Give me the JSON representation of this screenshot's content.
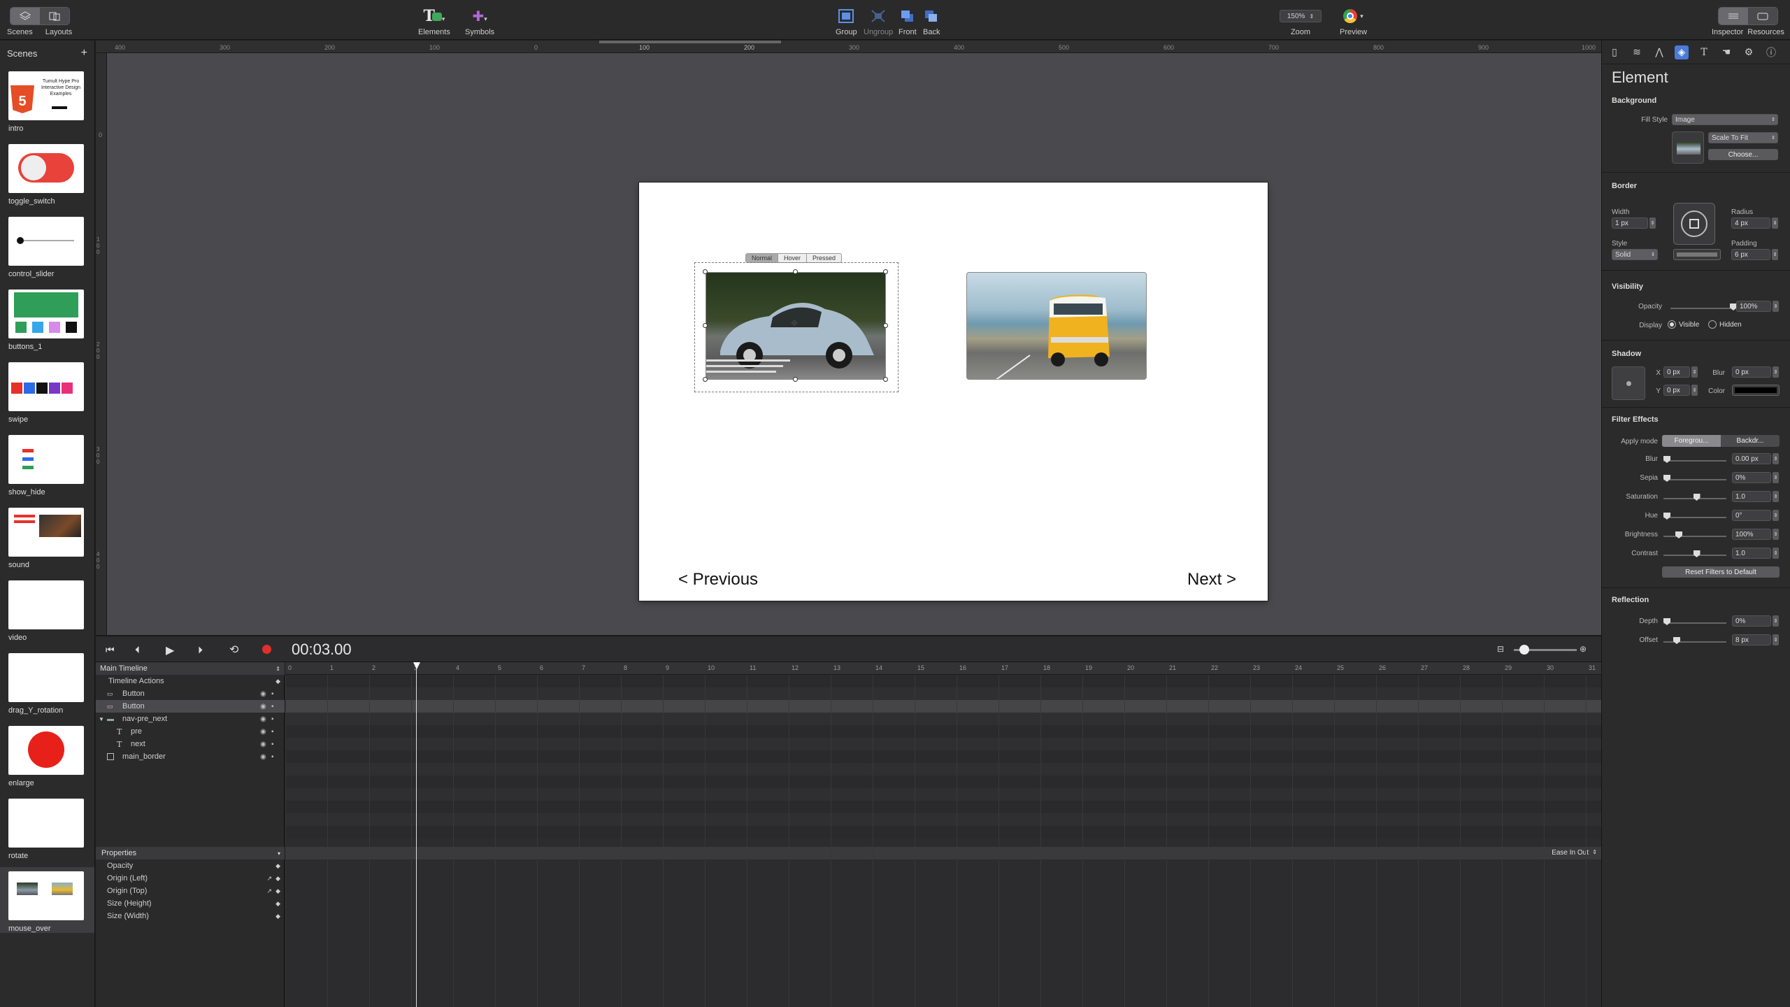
{
  "toolbar": {
    "scenes_label": "Scenes",
    "layouts_label": "Layouts",
    "elements_label": "Elements",
    "symbols_label": "Symbols",
    "group_label": "Group",
    "ungroup_label": "Ungroup",
    "front_label": "Front",
    "back_label": "Back",
    "zoom_value": "150%",
    "zoom_label": "Zoom",
    "preview_label": "Preview",
    "inspector_label": "Inspector",
    "resources_label": "Resources"
  },
  "scenes": {
    "title": "Scenes",
    "add": "+",
    "intro_thumb_text": "Tumult Hype Pro Interactive Design Examples",
    "items": [
      {
        "name": "intro"
      },
      {
        "name": "toggle_switch"
      },
      {
        "name": "control_slider"
      },
      {
        "name": "buttons_1"
      },
      {
        "name": "swipe"
      },
      {
        "name": "show_hide"
      },
      {
        "name": "sound"
      },
      {
        "name": "video"
      },
      {
        "name": "drag_Y_rotation"
      },
      {
        "name": "enlarge"
      },
      {
        "name": "rotate"
      },
      {
        "name": "mouse_over"
      }
    ]
  },
  "ruler": {
    "h_ticks": [
      "400",
      "300",
      "200",
      "100",
      "0",
      "100",
      "200",
      "300",
      "400",
      "500",
      "600",
      "700",
      "800",
      "900",
      "1000"
    ],
    "v_ticks": [
      "0",
      "100",
      "200",
      "300",
      "400"
    ]
  },
  "stage": {
    "button_states": [
      "Normal",
      "Hover",
      "Pressed"
    ],
    "prev_text": "< Previous",
    "next_text": "Next >"
  },
  "timeline": {
    "time": "00:03.00",
    "main_label": "Main Timeline",
    "actions_label": "Timeline Actions",
    "layers": [
      {
        "name": "Button",
        "kind": "button"
      },
      {
        "name": "Button",
        "kind": "button"
      },
      {
        "name": "nav-pre_next",
        "kind": "group"
      },
      {
        "name": "pre",
        "kind": "text"
      },
      {
        "name": "next",
        "kind": "text"
      },
      {
        "name": "main_border",
        "kind": "box"
      }
    ],
    "properties_label": "Properties",
    "easing": "Ease In Out",
    "properties": [
      "Opacity",
      "Origin (Left)",
      "Origin (Top)",
      "Size (Height)",
      "Size (Width)"
    ],
    "ticks": [
      "0",
      "1",
      "2",
      "3",
      "4",
      "5",
      "6",
      "7",
      "8",
      "9",
      "10",
      "11",
      "12",
      "13",
      "14",
      "15",
      "16",
      "17",
      "18",
      "19",
      "20",
      "21",
      "22",
      "23",
      "24",
      "25",
      "26",
      "27",
      "28",
      "29",
      "30",
      "31"
    ]
  },
  "inspector": {
    "title": "Element",
    "background": {
      "title": "Background",
      "fill_style_label": "Fill Style",
      "fill_style": "Image",
      "scale": "Scale To Fit",
      "choose": "Choose..."
    },
    "border": {
      "title": "Border",
      "width_label": "Width",
      "width": "1 px",
      "radius_label": "Radius",
      "radius": "4 px",
      "style_label": "Style",
      "style": "Solid",
      "padding_label": "Padding",
      "padding": "6 px"
    },
    "visibility": {
      "title": "Visibility",
      "opacity_label": "Opacity",
      "opacity": "100%",
      "display_label": "Display",
      "visible": "Visible",
      "hidden": "Hidden"
    },
    "shadow": {
      "title": "Shadow",
      "x_label": "X",
      "x": "0 px",
      "y_label": "Y",
      "y": "0 px",
      "blur_label": "Blur",
      "blur": "0 px",
      "color_label": "Color"
    },
    "filters": {
      "title": "Filter Effects",
      "apply_mode_label": "Apply mode",
      "foreground": "Foregrou...",
      "backdrop": "Backdr...",
      "rows": [
        {
          "label": "Blur",
          "value": "0.00 px",
          "level": 0
        },
        {
          "label": "Sepia",
          "value": "0%",
          "level": 0
        },
        {
          "label": "Saturation",
          "value": "1.0",
          "level": 0.5
        },
        {
          "label": "Hue",
          "value": "0°",
          "level": 0
        },
        {
          "label": "Brightness",
          "value": "100%",
          "level": 0.2
        },
        {
          "label": "Contrast",
          "value": "1.0",
          "level": 0.5
        }
      ],
      "reset": "Reset Filters to Default"
    },
    "reflection": {
      "title": "Reflection",
      "depth_label": "Depth",
      "depth": "0%",
      "offset_label": "Offset",
      "offset": "8 px"
    }
  }
}
